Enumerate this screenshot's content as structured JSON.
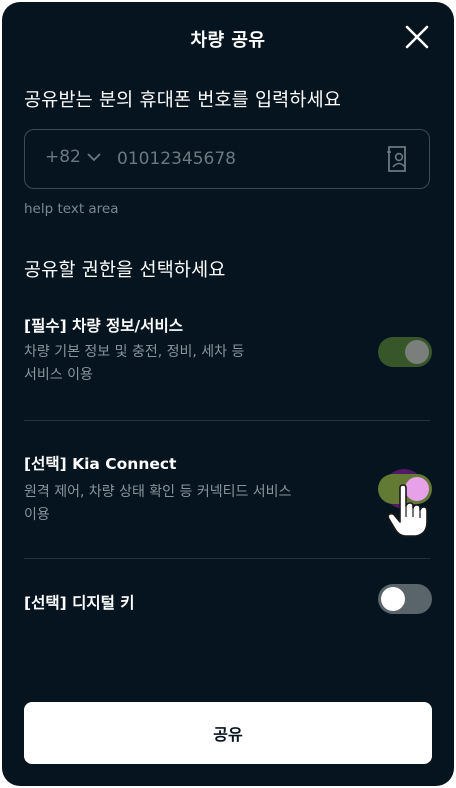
{
  "header": {
    "title": "차량 공유"
  },
  "phone_section": {
    "prompt": "공유받는 분의 휴대폰 번호를 입력하세요",
    "country_code": "+82",
    "placeholder": "01012345678",
    "help_text": "help text area"
  },
  "permissions": {
    "prompt": "공유할 권한을 선택하세요",
    "items": [
      {
        "title": "[필수] 차량 정보/서비스",
        "desc_line1": "차량 기본 정보 및 충전, 정비, 세차 등",
        "desc_line2": "서비스 이용",
        "state": "on"
      },
      {
        "title": "[선택] Kia Connect",
        "desc_line1": "원격 제어, 차량 상태 확인 등 커넥티드 서비스",
        "desc_line2": "이용",
        "state": "on"
      },
      {
        "title": "[선택] 디지털 키",
        "state": "off"
      }
    ]
  },
  "footer": {
    "share_label": "공유"
  },
  "colors": {
    "background": "#05141f",
    "toggle_on": "#37572a",
    "toggle_off": "#5a646b",
    "button": "#ffffff"
  }
}
